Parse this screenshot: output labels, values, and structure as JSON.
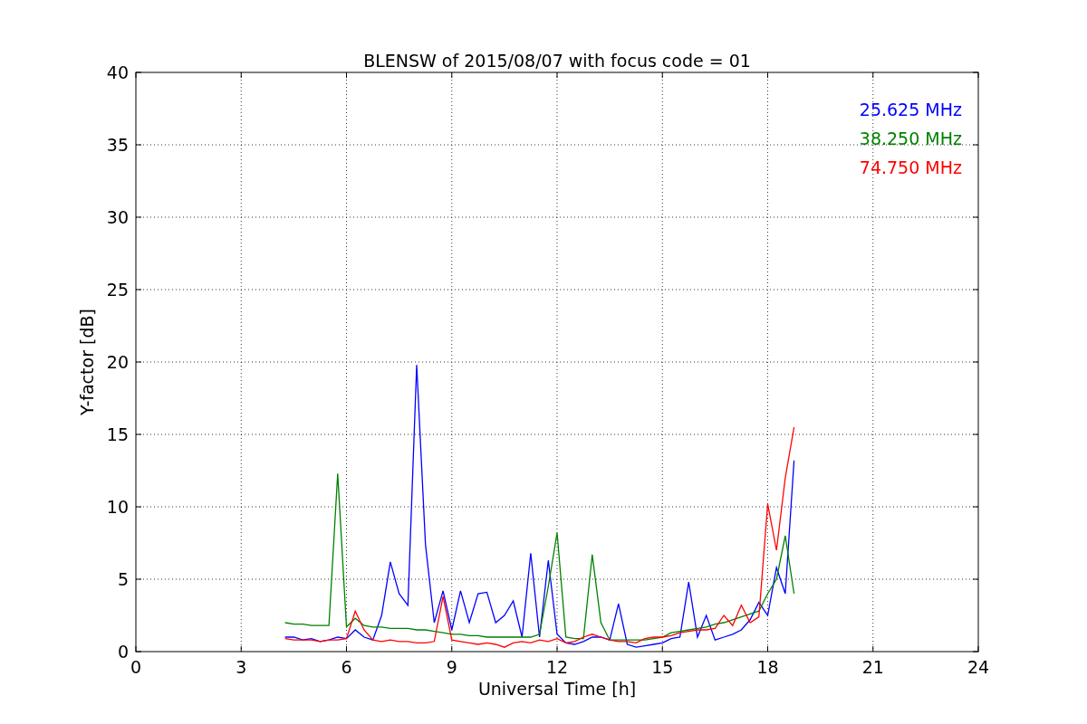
{
  "figure": {
    "chart_data": {
      "type": "line",
      "grid": true,
      "title": "BLENSW of 2015/08/07 with focus code = 01",
      "xlabel": "Universal Time [h]",
      "ylabel": "Y-factor [dB]",
      "xlim": [
        0,
        24
      ],
      "ylim": [
        0,
        40
      ],
      "xticks": [
        0,
        3,
        6,
        9,
        12,
        15,
        18,
        21,
        24
      ],
      "yticks": [
        0,
        5,
        10,
        15,
        20,
        25,
        30,
        35,
        40
      ],
      "x": [
        4.25,
        4.5,
        4.75,
        5,
        5.25,
        5.5,
        5.75,
        6,
        6.25,
        6.5,
        6.75,
        7,
        7.25,
        7.5,
        7.75,
        8,
        8.25,
        8.5,
        8.75,
        9,
        9.25,
        9.5,
        9.75,
        10,
        10.25,
        10.5,
        10.75,
        11,
        11.25,
        11.5,
        11.75,
        12,
        12.25,
        12.5,
        12.75,
        13,
        13.25,
        13.5,
        13.75,
        14,
        14.25,
        14.5,
        14.75,
        15,
        15.25,
        15.5,
        15.75,
        16,
        16.25,
        16.5,
        16.75,
        17,
        17.25,
        17.5,
        17.75,
        18,
        18.25,
        18.5,
        18.75
      ],
      "series": [
        {
          "name": "25.625 MHz",
          "color": "#0000ff",
          "values": [
            1.0,
            1.0,
            0.8,
            0.9,
            0.7,
            0.8,
            1.0,
            0.9,
            1.5,
            1.0,
            0.8,
            2.5,
            6.2,
            4.0,
            3.2,
            19.8,
            7.4,
            2.0,
            4.2,
            1.5,
            4.2,
            2.0,
            4.0,
            4.1,
            2.0,
            2.5,
            3.5,
            1.0,
            6.8,
            1.0,
            6.3,
            1.2,
            0.6,
            0.5,
            0.7,
            1.0,
            1.0,
            0.8,
            3.3,
            0.5,
            0.3,
            0.4,
            0.5,
            0.6,
            0.9,
            1.0,
            4.8,
            1.0,
            2.5,
            0.8,
            1.0,
            1.2,
            1.5,
            2.2,
            3.4,
            2.5,
            5.8,
            4.0,
            13.2
          ]
        },
        {
          "name": "38.250 MHz",
          "color": "#008000",
          "values": [
            2.0,
            1.9,
            1.9,
            1.8,
            1.8,
            1.8,
            12.3,
            1.7,
            2.3,
            1.8,
            1.7,
            1.7,
            1.6,
            1.6,
            1.6,
            1.5,
            1.5,
            1.4,
            1.3,
            1.2,
            1.2,
            1.1,
            1.1,
            1.0,
            1.0,
            1.0,
            1.0,
            1.0,
            1.0,
            1.2,
            4.5,
            8.2,
            1.0,
            0.9,
            0.9,
            6.7,
            2.0,
            0.8,
            0.8,
            0.8,
            0.8,
            0.8,
            0.9,
            1.0,
            1.3,
            1.4,
            1.5,
            1.6,
            1.7,
            1.9,
            2.0,
            2.2,
            2.4,
            2.6,
            2.8,
            4.0,
            5.0,
            8.0,
            4.0
          ]
        },
        {
          "name": "74.750 MHz",
          "color": "#ff0000",
          "values": [
            0.9,
            0.8,
            0.8,
            0.8,
            0.7,
            0.8,
            0.8,
            0.9,
            2.8,
            1.5,
            0.8,
            0.7,
            0.8,
            0.7,
            0.7,
            0.6,
            0.6,
            0.7,
            3.8,
            0.8,
            0.7,
            0.6,
            0.5,
            0.6,
            0.5,
            0.3,
            0.6,
            0.7,
            0.6,
            0.8,
            0.7,
            0.9,
            0.6,
            0.7,
            1.0,
            1.2,
            1.0,
            0.8,
            0.7,
            0.7,
            0.6,
            0.9,
            1.0,
            1.0,
            1.1,
            1.3,
            1.4,
            1.5,
            1.5,
            1.6,
            2.5,
            1.8,
            3.2,
            2.0,
            2.4,
            10.2,
            7.0,
            12.0,
            15.5
          ]
        }
      ]
    }
  }
}
